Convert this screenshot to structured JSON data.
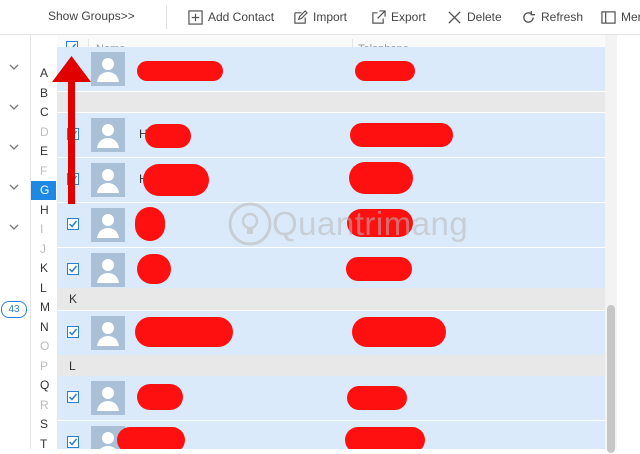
{
  "toolbar": {
    "show_groups": "Show Groups>>",
    "add_contact": "Add Contact",
    "import": "Import",
    "export": "Export",
    "delete": "Delete",
    "refresh": "Refresh",
    "more": "Mer"
  },
  "columns": {
    "name": "Name",
    "telephone": "Telephone"
  },
  "count_badge": "43",
  "alphabet": [
    {
      "letter": "A",
      "state": "on"
    },
    {
      "letter": "B",
      "state": "on"
    },
    {
      "letter": "C",
      "state": "on"
    },
    {
      "letter": "D",
      "state": "off"
    },
    {
      "letter": "E",
      "state": "on"
    },
    {
      "letter": "F",
      "state": "off"
    },
    {
      "letter": "G",
      "state": "active"
    },
    {
      "letter": "H",
      "state": "on"
    },
    {
      "letter": "I",
      "state": "off"
    },
    {
      "letter": "J",
      "state": "off"
    },
    {
      "letter": "K",
      "state": "on"
    },
    {
      "letter": "L",
      "state": "on"
    },
    {
      "letter": "M",
      "state": "on"
    },
    {
      "letter": "N",
      "state": "on"
    },
    {
      "letter": "O",
      "state": "off"
    },
    {
      "letter": "P",
      "state": "off"
    },
    {
      "letter": "Q",
      "state": "on"
    },
    {
      "letter": "R",
      "state": "off"
    },
    {
      "letter": "S",
      "state": "on"
    },
    {
      "letter": "T",
      "state": "on"
    }
  ],
  "groups": {
    "k": "K",
    "l": "L"
  },
  "contacts": [
    {
      "name": "",
      "telephone": "",
      "checked": true
    },
    {
      "name": "H",
      "telephone": "",
      "checked": true
    },
    {
      "name": "H",
      "telephone": "",
      "checked": true
    },
    {
      "name": "",
      "telephone": "",
      "checked": true
    },
    {
      "name": "",
      "telephone": "",
      "checked": true
    },
    {
      "name": "",
      "telephone": "",
      "checked": true
    },
    {
      "name": "",
      "telephone": "",
      "checked": true
    },
    {
      "name": "",
      "telephone": "",
      "checked": true
    }
  ],
  "watermark": "Quantrimang",
  "colors": {
    "accent": "#1e88e5",
    "row_selected": "#dbeafb",
    "redaction": "#ff1010",
    "arrow": "#e00000"
  }
}
